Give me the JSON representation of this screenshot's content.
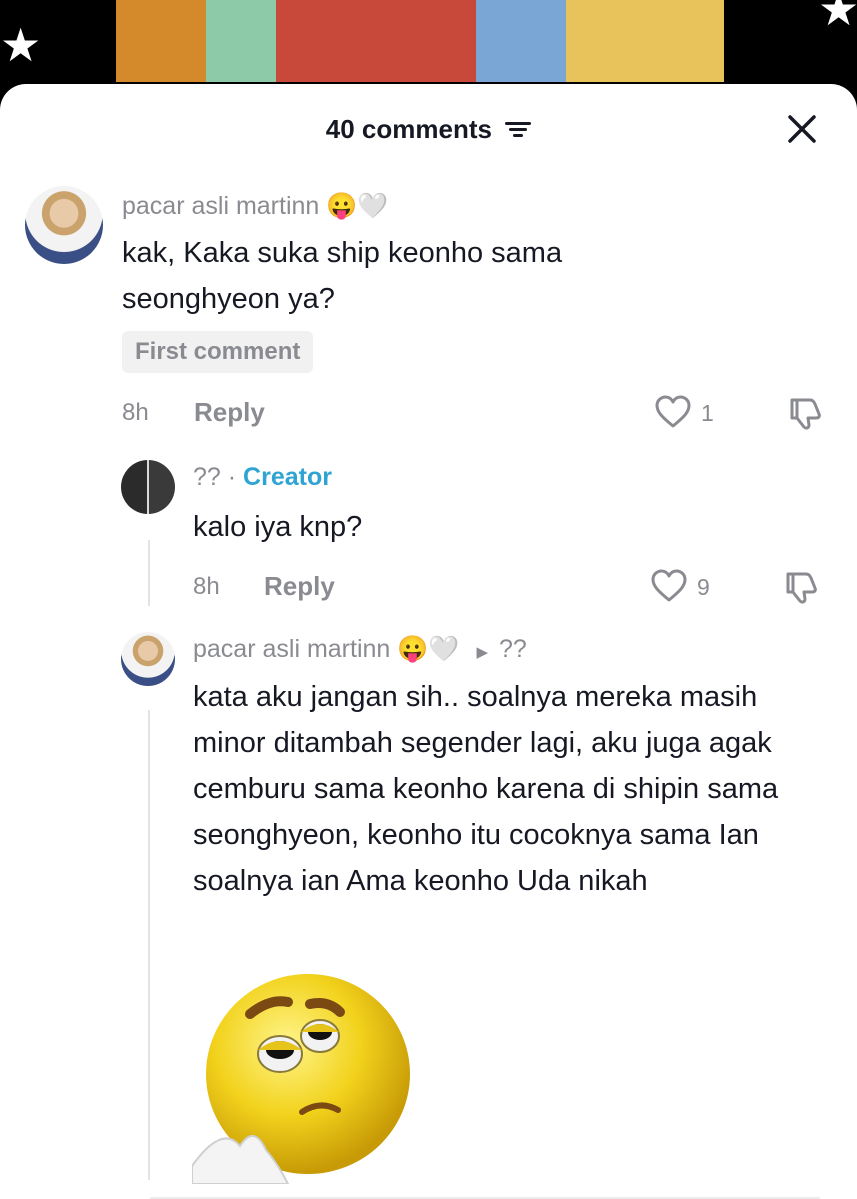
{
  "header": {
    "comment_count_label": "40 comments"
  },
  "icons": {
    "filter": "filter-icon",
    "close": "close-icon",
    "like": "heart-outline-icon",
    "dislike": "thumbs-down-icon",
    "reply_arrow": "play-arrow-icon"
  },
  "colors": {
    "sheet_bg": "#ffffff",
    "muted_text": "#8a8b91",
    "creator_accent": "#2fa4d2",
    "primary_text": "#161823"
  },
  "comments": [
    {
      "username": "pacar asli martinn",
      "emojis": "😛🤍",
      "text": "kak, Kaka suka ship keonho sama seonghyeon ya?",
      "badge": "First comment",
      "time": "8h",
      "reply_label": "Reply",
      "likes": "1"
    },
    {
      "username": "??",
      "separator": "·",
      "role": "Creator",
      "text": "kalo iya knp?",
      "time": "8h",
      "reply_label": "Reply",
      "likes": "9"
    },
    {
      "username": "pacar asli martinn",
      "emojis": "😛🤍",
      "reply_to": "??",
      "text": "kata aku jangan sih.. soalnya mereka masih minor ditambah segender lagi, aku juga agak cemburu sama keonho karena di shipin sama seonghyeon, keonho itu cocoknya sama Ian soalnya ian Ama keonho Uda nikah",
      "sticker": "tired-face-emoji-sticker"
    }
  ]
}
